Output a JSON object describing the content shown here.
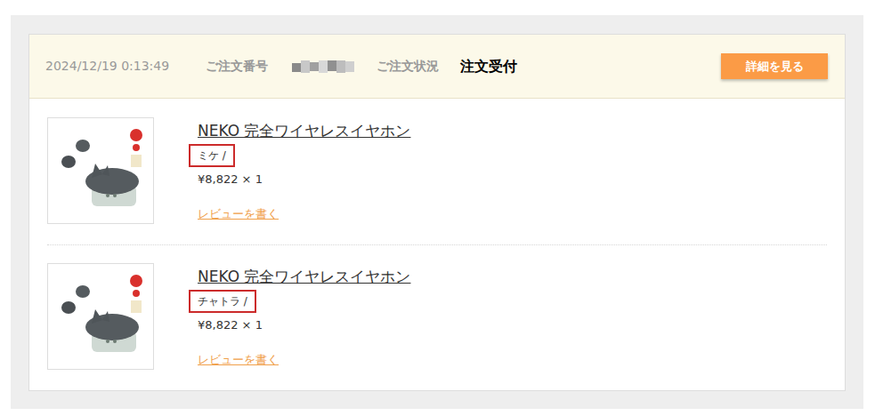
{
  "order": {
    "datetime": "2024/12/19 0:13:49",
    "number_label": "ご注文番号",
    "status_label": "ご注文状況",
    "status": "注文受付",
    "detail_button": "詳細を見る"
  },
  "items": [
    {
      "title": "NEKO 完全ワイヤレスイヤホン",
      "variant": "ミケ /",
      "highlighted": true,
      "price": "¥8,822 × 1",
      "review_link": "レビューを書く"
    },
    {
      "title": "NEKO 完全ワイヤレスイヤホン",
      "variant": "チャトラ /",
      "highlighted": true,
      "price": "¥8,822 × 1",
      "review_link": "レビューを書く"
    }
  ]
}
